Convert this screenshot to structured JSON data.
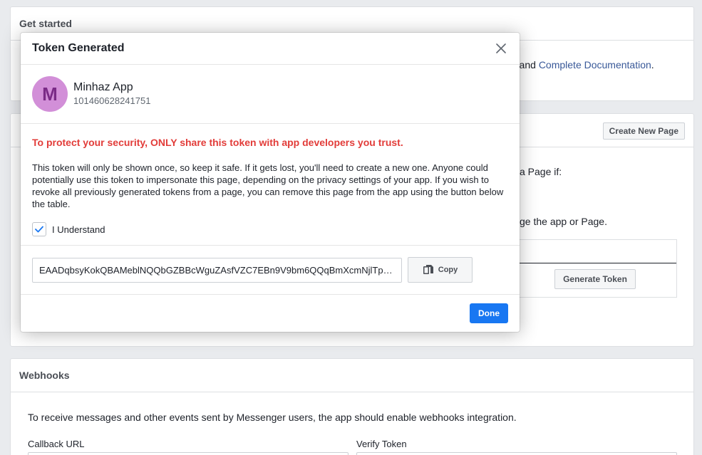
{
  "background": {
    "get_started": {
      "title": "Get started",
      "text_before_link": ") and ",
      "link": "Complete Documentation",
      "text_after_link": "."
    },
    "access_tokens": {
      "create_page_button": "Create New Page",
      "text1": "a Page if:",
      "text2": "ge the app or Page.",
      "generate_token_button": "Generate Token"
    },
    "webhooks": {
      "title": "Webhooks",
      "description": "To receive messages and other events sent by Messenger users, the app should enable webhooks integration.",
      "callback_url_label": "Callback URL",
      "verify_token_label": "Verify Token"
    }
  },
  "modal": {
    "title": "Token Generated",
    "page": {
      "avatar_letter": "M",
      "name": "Minhaz App",
      "id": "101460628241751"
    },
    "warning_title": "To protect your security, ONLY share this token with app developers you trust.",
    "warning_body": "This token will only be shown once, so keep it safe. If it gets lost, you'll need to create a new one. Anyone could potentially use this token to impersonate this page, depending on the privacy settings of your app. If you wish to revoke all previously generated tokens from a page, you can remove this page from the app using the button below the table.",
    "understand_label": "I Understand",
    "understand_checked": true,
    "token_value": "EAADqbsyKokQBAMeblNQQbGZBBcWguZAsfVZC7EBn9V9bm6QQqBmXcmNjlTp…",
    "copy_label": "Copy",
    "done_label": "Done"
  },
  "colors": {
    "warning": "#e23c39",
    "link": "#385898",
    "primary_button": "#1877f2",
    "avatar_bg": "#d28fd8",
    "avatar_fg": "#7a2a86"
  },
  "icons": {
    "close": "close-icon",
    "check": "checkmark-icon",
    "copy": "copy-icon"
  }
}
